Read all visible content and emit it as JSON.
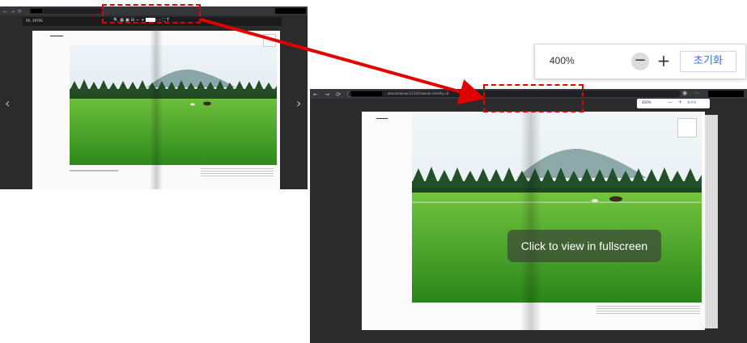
{
  "small_window": {
    "toolbar_label": "Fill, 1970S",
    "prev_glyph": "‹",
    "next_glyph": "›"
  },
  "large_window": {
    "url_text": "...ebook/ebook/12345/ebook.html#p=8",
    "mini_zoom": {
      "value": "400%",
      "controls": "− +",
      "reset": "초기화"
    },
    "fullscreen_hint": "Click to view in fullscreen"
  },
  "zoom_panel": {
    "value": "400%",
    "minus_label": "−",
    "plus_label": "+",
    "reset_label": "초기화"
  },
  "colors": {
    "highlight": "#e00000",
    "reset_text": "#3b6fd8",
    "viewer_background": "#2b2b2b"
  },
  "icons": [
    "search-icon",
    "grid-icon",
    "print-icon",
    "bookmark-icon",
    "fullscreen-icon",
    "text-icon",
    "minus-icon",
    "plus-icon",
    "prev-page-icon",
    "next-page-icon"
  ]
}
